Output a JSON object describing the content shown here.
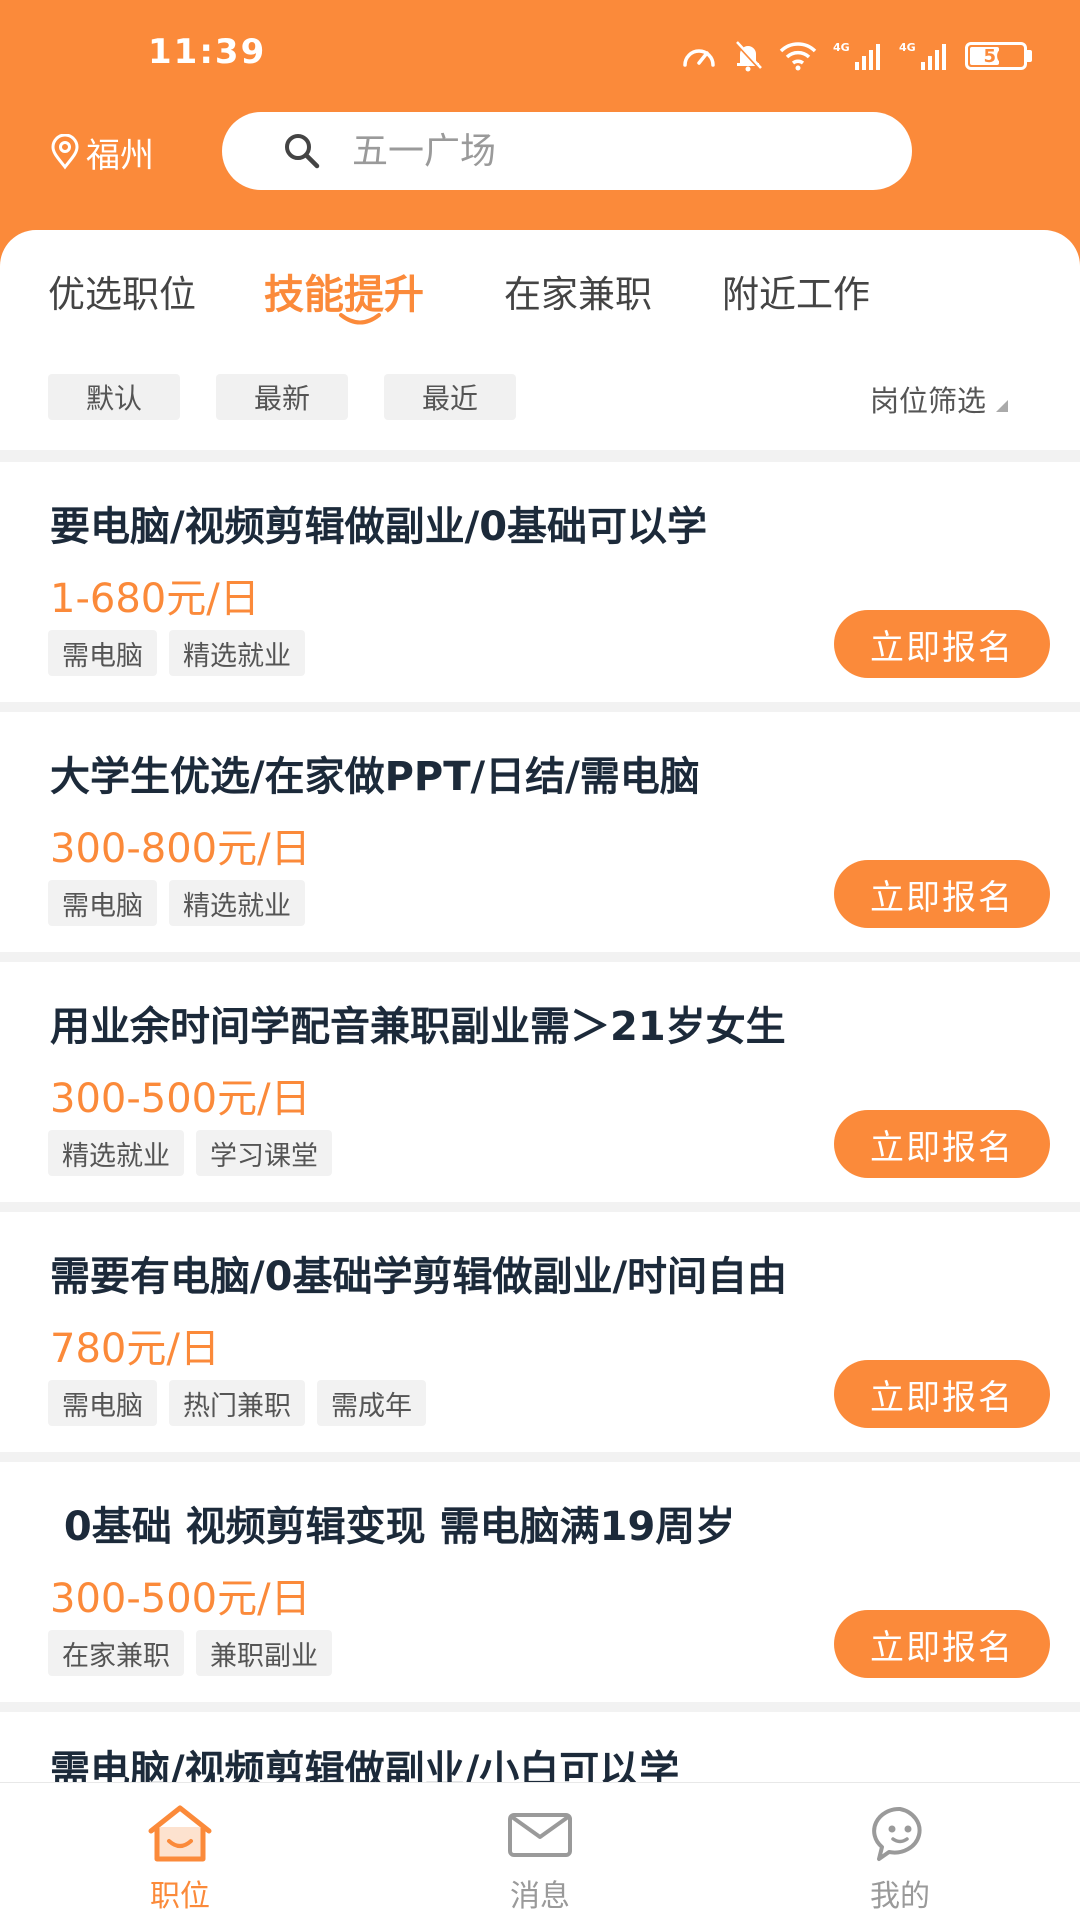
{
  "status_bar": {
    "time": "11:39",
    "battery": "56",
    "battery_level": 0.56,
    "network_1": "4G",
    "network_2": "4G",
    "icons": [
      "speedometer-icon",
      "bell-off-icon",
      "wifi-icon",
      "signal-icon",
      "signal-icon",
      "battery-icon"
    ]
  },
  "header": {
    "city": "福州",
    "city_icon": "location-pin-icon",
    "search_placeholder": "五一广场",
    "search_icon": "search-icon"
  },
  "tabs": [
    {
      "label": "优选职位",
      "active": false
    },
    {
      "label": "技能提升",
      "active": true
    },
    {
      "label": "在家兼职",
      "active": false
    },
    {
      "label": "附近工作",
      "active": false
    }
  ],
  "filters": {
    "chips": [
      "默认",
      "最新",
      "最近"
    ],
    "post_filter_label": "岗位筛选"
  },
  "jobs": [
    {
      "title": "要电脑/视频剪辑做副业/0基础可以学",
      "salary": "1-680元/日",
      "tags": [
        "需电脑",
        "精选就业"
      ],
      "apply_label": "立即报名"
    },
    {
      "title": "大学生优选/在家做PPT/日结/需电脑",
      "salary": "300-800元/日",
      "tags": [
        "需电脑",
        "精选就业"
      ],
      "apply_label": "立即报名"
    },
    {
      "title": "用业余时间学配音兼职副业需＞21岁女生",
      "salary": "300-500元/日",
      "tags": [
        "精选就业",
        "学习课堂"
      ],
      "apply_label": "立即报名"
    },
    {
      "title": "需要有电脑/0基础学剪辑做副业/时间自由",
      "salary": "780元/日",
      "tags": [
        "需电脑",
        "热门兼职",
        "需成年"
      ],
      "apply_label": "立即报名"
    },
    {
      "title": " 0基础 视频剪辑变现 需电脑满19周岁",
      "salary": "300-500元/日",
      "tags": [
        "在家兼职",
        "兼职副业"
      ],
      "apply_label": "立即报名"
    },
    {
      "title": "需电脑/视频剪辑做副业/小白可以学",
      "salary": "",
      "tags": [],
      "apply_label": ""
    }
  ],
  "bottom_nav": [
    {
      "label": "职位",
      "icon": "home-icon",
      "active": true
    },
    {
      "label": "消息",
      "icon": "mail-icon",
      "active": false
    },
    {
      "label": "我的",
      "icon": "chat-face-icon",
      "active": false
    }
  ],
  "colors": {
    "brand_orange": "#fb8a3a",
    "title_text": "#1c2a3a",
    "muted_text": "#9a9a9a"
  }
}
